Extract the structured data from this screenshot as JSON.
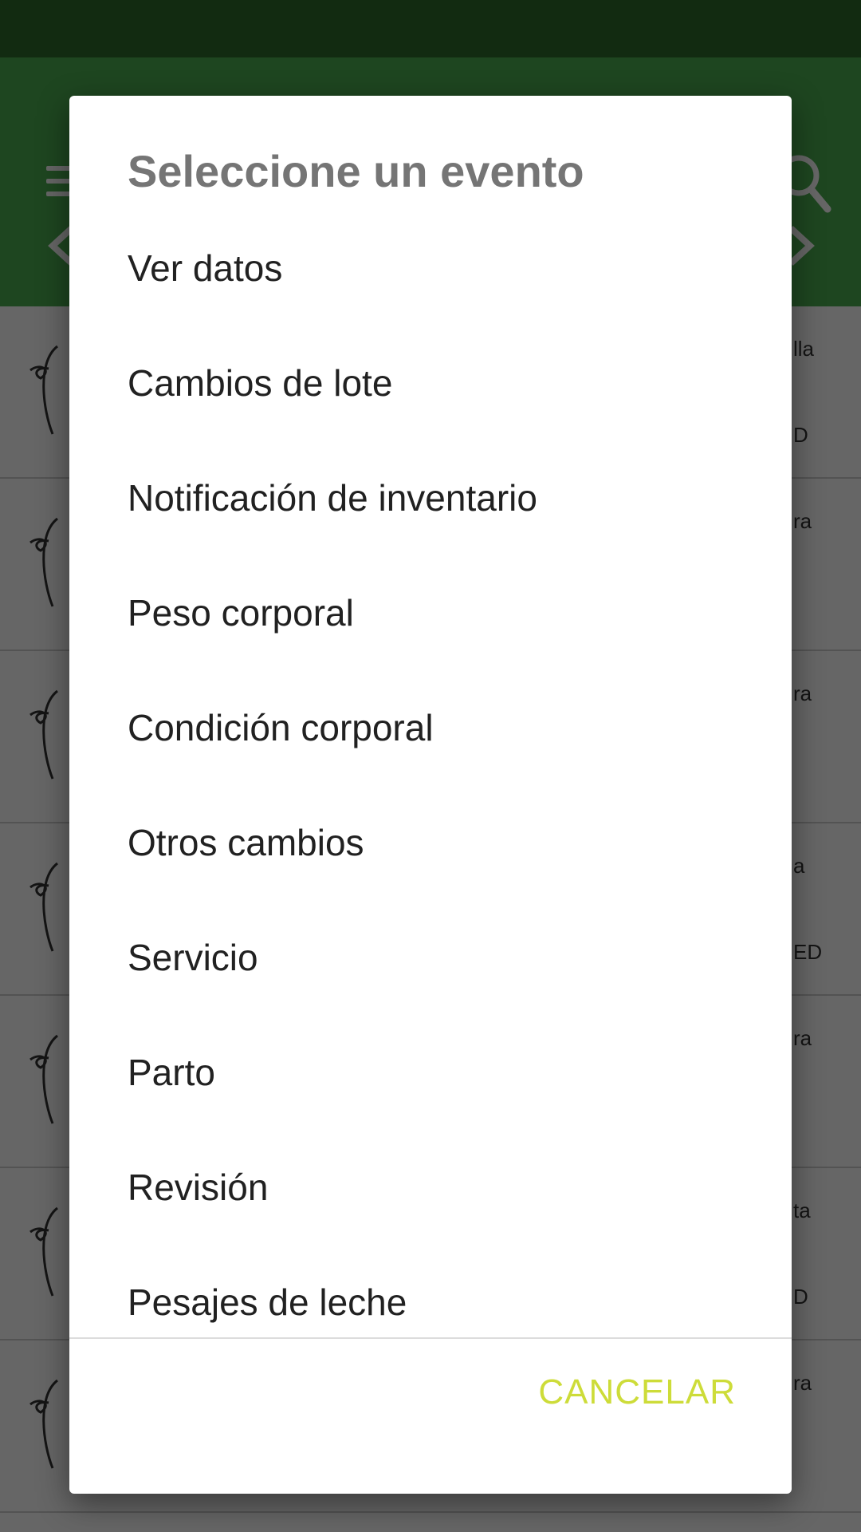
{
  "colors": {
    "status_bar": "#2e6b2b",
    "app_bar": "#4caf50",
    "dialog_title": "#757575",
    "dialog_item": "#212121",
    "cancel_accent": "#cddc39"
  },
  "icons": {
    "menu": "menu-icon",
    "search": "search-icon",
    "prev": "chevron-left-icon",
    "next": "chevron-right-icon",
    "animal": "animal-icon"
  },
  "background_list": [
    {
      "right_top": "lla",
      "right_bottom": "D"
    },
    {
      "right_top": "ra",
      "right_bottom": ""
    },
    {
      "right_top": "ra",
      "right_bottom": ""
    },
    {
      "right_top": "a",
      "right_bottom": "ED"
    },
    {
      "right_top": "ra",
      "right_bottom": ""
    },
    {
      "right_top": "ta",
      "right_bottom": "D"
    },
    {
      "right_top": "ra",
      "right_bottom": ""
    }
  ],
  "dialog": {
    "title": "Seleccione un evento",
    "items": [
      "Ver datos",
      "Cambios de lote",
      "Notificación de inventario",
      "Peso corporal",
      "Condición corporal",
      "Otros cambios",
      "Servicio",
      "Parto",
      "Revisión",
      "Pesajes de leche"
    ],
    "cancel_label": "CANCELAR"
  }
}
